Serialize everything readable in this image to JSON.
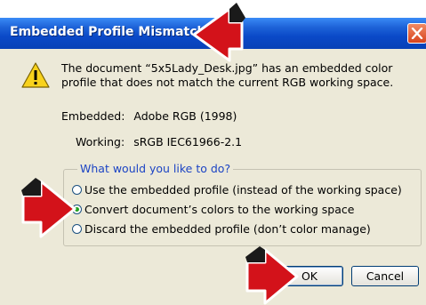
{
  "window": {
    "title": "Embedded Profile Mismatch"
  },
  "message": {
    "line1": "The document “5x5Lady_Desk.jpg” has an embedded color",
    "line2": "profile that does not match the current RGB working space."
  },
  "profiles": {
    "embedded_label": "Embedded:",
    "embedded_value": "Adobe RGB (1998)",
    "working_label": "Working:",
    "working_value": "sRGB IEC61966-2.1"
  },
  "options": {
    "legend": "What would you like to do?",
    "items": [
      {
        "label": "Use the embedded profile (instead of the working space)",
        "selected": false
      },
      {
        "label": "Convert document’s colors to the working space",
        "selected": true
      },
      {
        "label": "Discard the embedded profile (don’t color manage)",
        "selected": false
      }
    ]
  },
  "buttons": {
    "ok": "OK",
    "cancel": "Cancel"
  },
  "colors": {
    "titlebar": "#0a49c8",
    "arrow": "#d3121a",
    "legend_text": "#1c44c4"
  }
}
